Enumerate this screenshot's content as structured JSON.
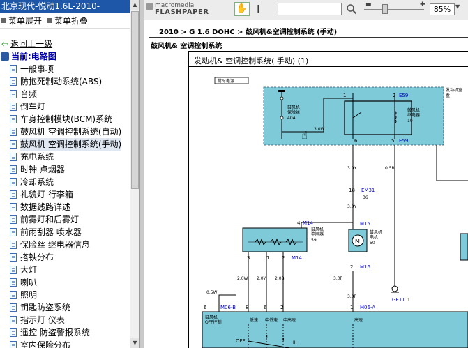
{
  "left_pane": {
    "title": "北京现代-悦动1.6L-2010-",
    "toolbar": {
      "expand_label": "菜单展开",
      "collapse_label": "菜单折叠"
    },
    "back_label": "返回上一级",
    "current_label": "当前:电路图",
    "items": [
      "一般事项",
      "防抱死制动系统(ABS)",
      "音频",
      "倒车灯",
      "车身控制模块(BCM)系统",
      "鼓风机 空调控制系统(自动)",
      "鼓风机 空调控制系统(手动)",
      "充电系统",
      "时钟 点烟器",
      "冷却系统",
      "礼貌灯 行李箱",
      "数据线路详述",
      "前雾灯和后雾灯",
      "前雨刮器 喷水器",
      "保险丝 继电器信息",
      "搭铁分布",
      "大灯",
      "喇叭",
      "照明",
      "钥匙防盗系统",
      "指示灯 仪表",
      "遥控 防盗警报系统",
      "室内保险分布"
    ],
    "selected_index": 6
  },
  "viewer": {
    "logo_line1": "macromedia",
    "logo_line2": "FLASHPAPER",
    "search_value": "",
    "zoom_value": "85%",
    "zoom_level_fraction": 0.35
  },
  "document": {
    "breadcrumb": "2010 > G 1.6 DOHC > 鼓风机&空调控制系统 (手动)",
    "subtitle": "鼓风机& 空调控制系统",
    "frame_title": "发动机& 空调控制系统( 手动) (1)",
    "labels": {
      "hot_always": "常时电源",
      "fuse_name": "鼓风机",
      "fuse_sub": "保险丝",
      "fuse_amp": "40A",
      "relay_name": "鼓风机",
      "relay_sub": "继电器",
      "relay_num": "10",
      "relay_box": "发动机室",
      "relay_box2": "盒",
      "e59": "E59",
      "pin1": "1",
      "pin2": "2",
      "pin4a": "4",
      "pin6": "6",
      "pin5": "5",
      "wire_3w": "3.0W",
      "wire_3y": "3.0Y",
      "wire_05b": "0.5B",
      "em31": "EM31",
      "em31_page": "36",
      "pin18": "18",
      "wire_3y_b": "3.0Y",
      "m14": "M14",
      "pin4b": "4",
      "resistor_name": "鼓风机",
      "resistor_sub": "电阻器",
      "resistor_page": "59",
      "m15": "M15",
      "motor_name": "鼓风机",
      "motor_sub": "电机",
      "motor_page": "50",
      "pin1b": "1",
      "pin2b": "2",
      "pin3": "3",
      "pin1c": "1",
      "pin2c": "2",
      "m14b": "M14",
      "m16": "M16",
      "wire_2w": "2.0W",
      "wire_2y": "2.0Y",
      "wire_2b": "2.0B",
      "wire_3p": "3.0P",
      "wire_3p_b": "3.0P",
      "wire_05w": "0.5W",
      "ge11": "GE11",
      "ge11_page": "1",
      "pin6b": "6",
      "m06b": "M06-B",
      "pin8": "8",
      "pin6c": "6",
      "pin2d": "2",
      "pin1d": "1",
      "m06a": "M06-A",
      "switch_name": "鼓风机",
      "switch_sub": "OFF控制",
      "s_low": "低速",
      "s_mlow": "中低速",
      "s_mhigh": "中高速",
      "s_high": "高速",
      "off": "OFF",
      "s_i": "I",
      "s_ii": "II",
      "s_iii": "III"
    }
  },
  "colors": {
    "title_bar": "#1f57a8",
    "component_fill": "#7fcad8",
    "selected_row": "#dfe7f3"
  }
}
